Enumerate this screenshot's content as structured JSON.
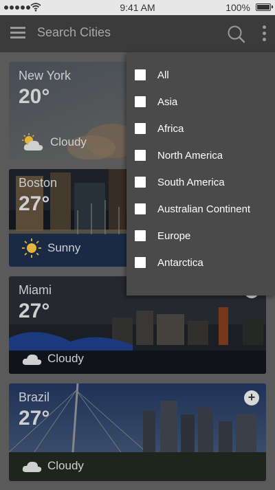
{
  "status_bar": {
    "time": "9:41 AM",
    "battery": "100%"
  },
  "header": {
    "search_placeholder": "Search Cities"
  },
  "cities": [
    {
      "name": "New York",
      "temp": "20°",
      "condition": "Cloudy",
      "icon": "partly-cloudy-icon"
    },
    {
      "name": "Boston",
      "temp": "27°",
      "condition": "Sunny",
      "icon": "sun-icon"
    },
    {
      "name": "Miami",
      "temp": "27°",
      "condition": "Cloudy",
      "icon": "cloud-icon"
    },
    {
      "name": "Brazil",
      "temp": "27°",
      "condition": "Cloudy",
      "icon": "cloud-icon"
    }
  ],
  "filter_menu": {
    "options": [
      "All",
      "Asia",
      "Africa",
      "North America",
      "South America",
      "Australian Continent",
      "Europe",
      "Antarctica"
    ]
  },
  "colors": {
    "header": "#3b3b3b",
    "dropdown": "#4a4a4a",
    "status_bar": "#e7e7e7"
  }
}
